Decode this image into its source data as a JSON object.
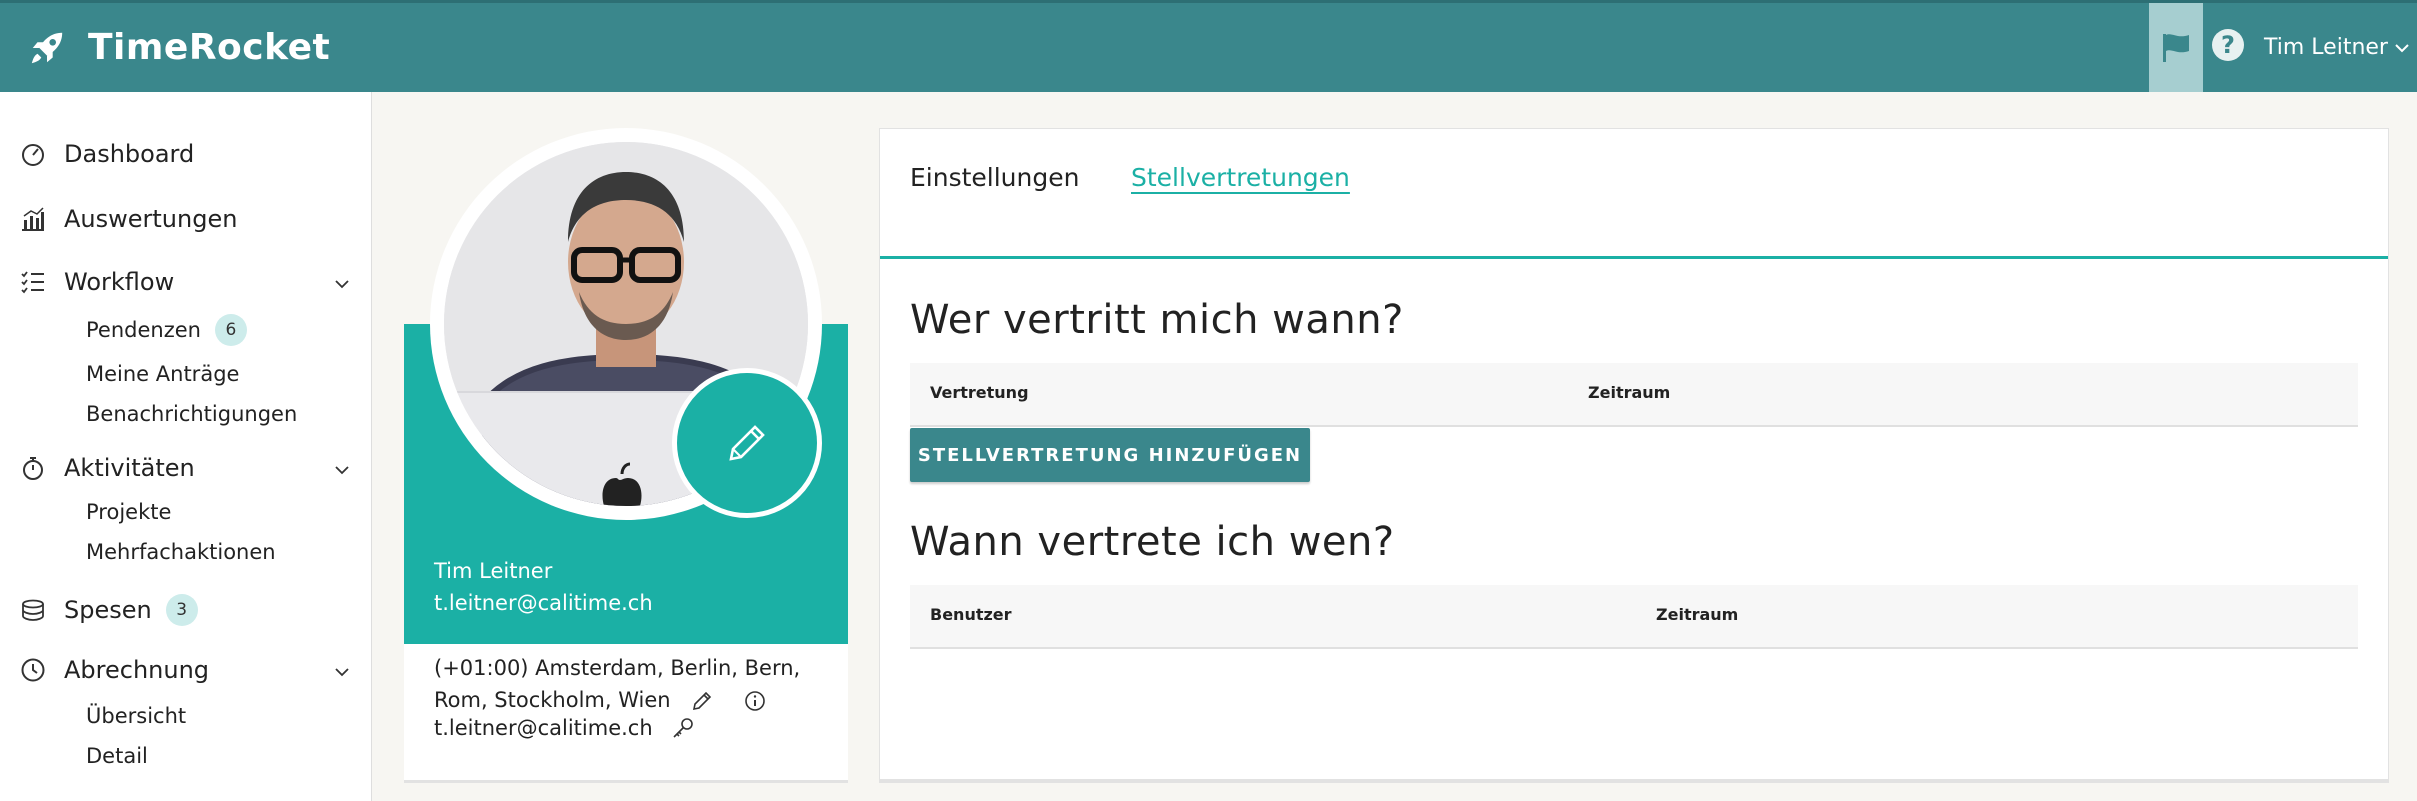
{
  "app": {
    "name": "TimeRocket"
  },
  "header": {
    "user_name": "Tim Leitner",
    "help_label": "?"
  },
  "sidebar": {
    "dashboard": "Dashboard",
    "auswertungen": "Auswertungen",
    "workflow": "Workflow",
    "pendenzen": "Pendenzen",
    "pendenzen_count": "6",
    "meine_antraege": "Meine Anträge",
    "benachrichtigungen": "Benachrichtigungen",
    "aktivitaeten": "Aktivitäten",
    "projekte": "Projekte",
    "mehrfachaktionen": "Mehrfachaktionen",
    "spesen": "Spesen",
    "spesen_count": "3",
    "abrechnung": "Abrechnung",
    "uebersicht": "Übersicht",
    "detail": "Detail"
  },
  "profile": {
    "name": "Tim Leitner",
    "email": "t.leitner@calitime.ch",
    "timezone": "(+01:00) Amsterdam, Berlin, Bern, Rom, Stockholm, Wien",
    "login_email": "t.leitner@calitime.ch"
  },
  "tabs": {
    "settings": "Einstellungen",
    "deputies": "Stellvertretungen"
  },
  "section1": {
    "title": "Wer vertritt mich wann?",
    "col1": "Vertretung",
    "col2": "Zeitraum",
    "add_button": "STELLVERTRETUNG HINZUFÜGEN"
  },
  "section2": {
    "title": "Wann vertrete ich wen?",
    "col1": "Benutzer",
    "col2": "Zeitraum"
  },
  "colors": {
    "header": "#3a878c",
    "accent": "#1bb0a5",
    "flag_bg": "#a6ced0"
  }
}
